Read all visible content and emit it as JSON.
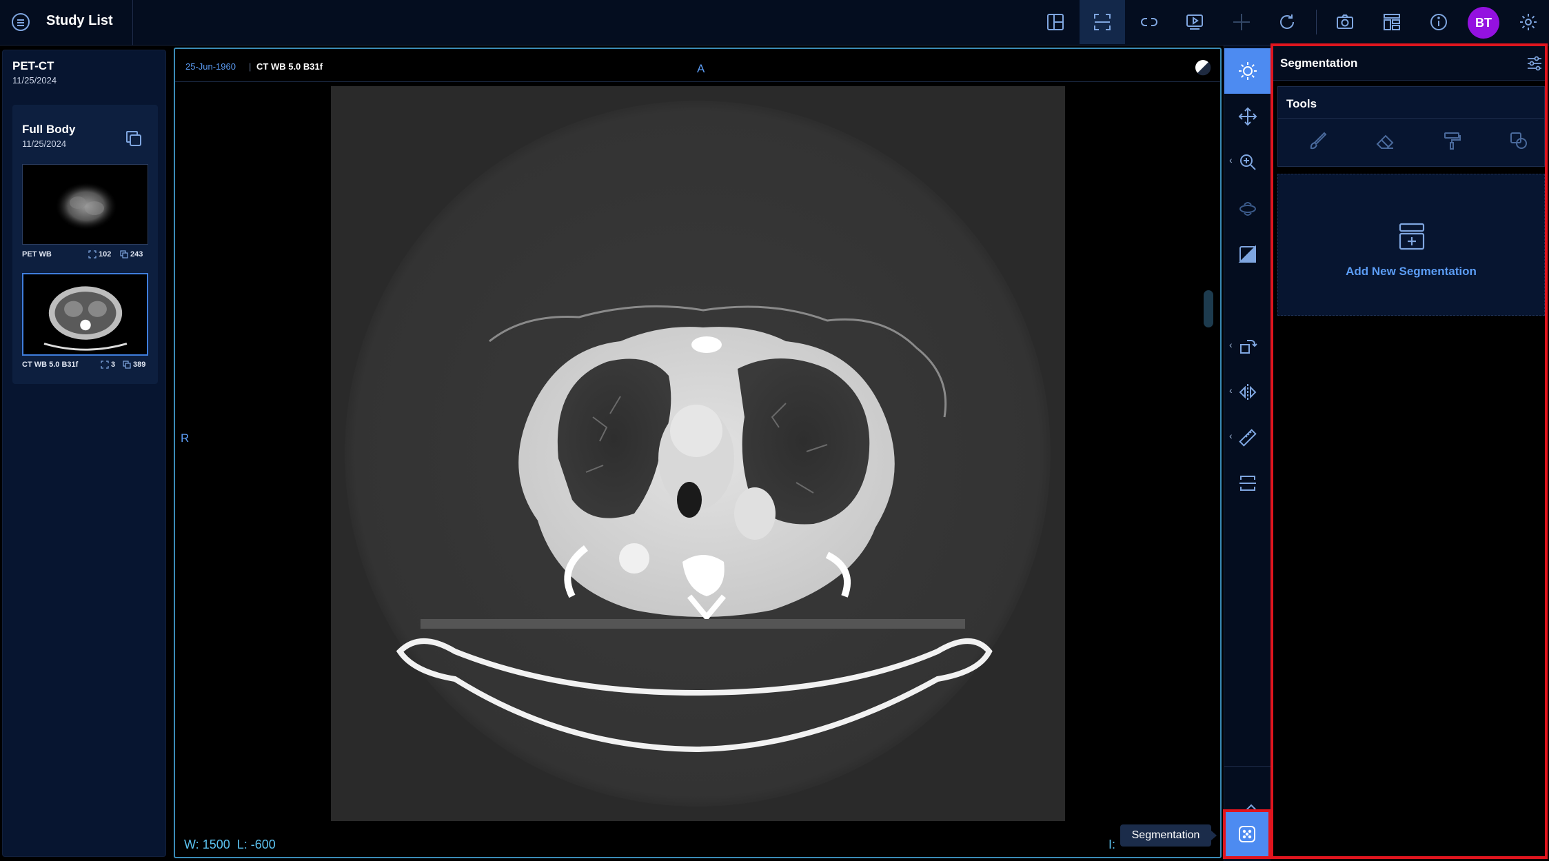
{
  "header": {
    "title": "Study List",
    "avatar_initials": "BT",
    "toolbar": [
      {
        "name": "layout-icon"
      },
      {
        "name": "viewport-scroll-icon",
        "active": true
      },
      {
        "name": "link-icon"
      },
      {
        "name": "cine-icon"
      },
      {
        "name": "crosshair-icon",
        "disabled": true
      },
      {
        "name": "reset-icon"
      },
      {
        "name": "camera-icon"
      },
      {
        "name": "hanging-protocol-icon"
      },
      {
        "name": "info-icon"
      },
      {
        "name": "settings-icon"
      }
    ]
  },
  "study": {
    "modality": "PET-CT",
    "date": "11/25/2024",
    "group": {
      "title": "Full Body",
      "date": "11/25/2024",
      "series": [
        {
          "label": "PET WB",
          "instances": "102",
          "images": "243"
        },
        {
          "label": "CT WB 5.0 B31f",
          "instances": "3",
          "images": "389",
          "selected": true
        }
      ]
    }
  },
  "viewport": {
    "date": "25-Jun-1960",
    "series": "CT WB 5.0 B31f",
    "orientation_top": "A",
    "orientation_left": "R",
    "window_label": "W:",
    "window_value": "1500",
    "level_label": "L:",
    "level_value": "-600",
    "index_label": "I:"
  },
  "tools": {
    "items": [
      "brightness-icon",
      "pan-icon",
      "zoom-icon",
      "3d-rotate-icon",
      "window-level-icon",
      "rotate-icon",
      "flip-icon",
      "measure-icon",
      "reference-lines-icon",
      "annotate-icon",
      "segmentation-icon"
    ],
    "tooltip": "Segmentation"
  },
  "segmentation_panel": {
    "title": "Segmentation",
    "tools_title": "Tools",
    "tool_icons": [
      "brush-icon",
      "eraser-icon",
      "paint-fill-icon",
      "shapes-icon"
    ],
    "add_label": "Add New Segmentation"
  },
  "colors": {
    "accent": "#4d8bf1",
    "highlight": "#e0151e",
    "text_accent": "#5b9cf4",
    "avatar": "#9411e0"
  }
}
